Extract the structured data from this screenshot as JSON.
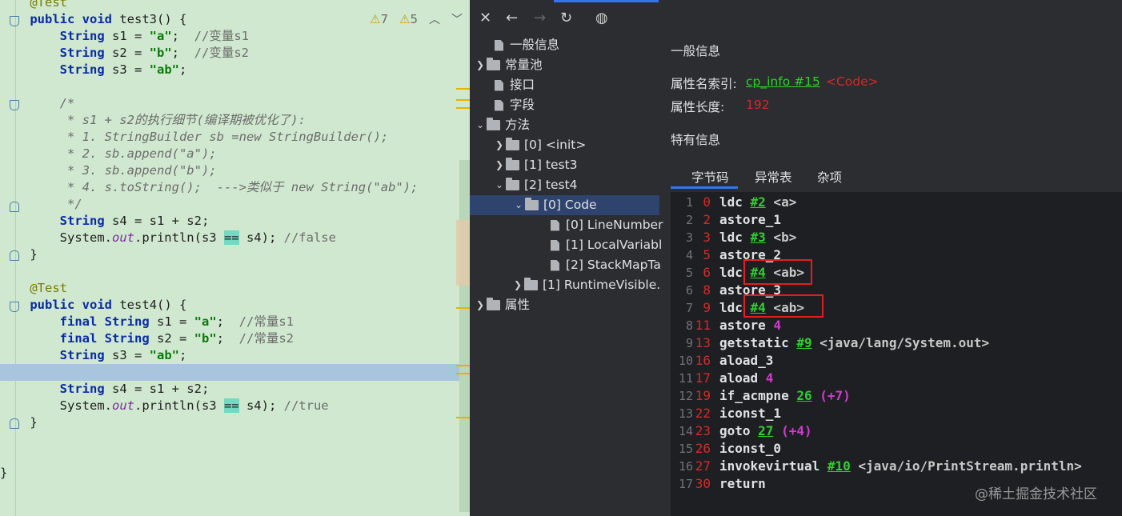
{
  "editor": {
    "inspections": {
      "warnings_a": "7",
      "warnings_b": "5"
    },
    "lines": [
      {
        "text": "    @Test"
      },
      {
        "text": "    public void test3() {"
      },
      {
        "text": "        String s1 = \"a\";  //变量s1"
      },
      {
        "text": "        String s2 = \"b\";  //变量s2"
      },
      {
        "text": "        String s3 = \"ab\";"
      },
      {
        "text": ""
      },
      {
        "text": "        /*"
      },
      {
        "text": "         * s1 + s2的执行细节(编译期被优化了):"
      },
      {
        "text": "         * 1. StringBuilder sb =new StringBuilder();"
      },
      {
        "text": "         * 2. sb.append(\"a\");"
      },
      {
        "text": "         * 3. sb.append(\"b\");"
      },
      {
        "text": "         * 4. s.toString();  --->类似于 new String(\"ab\");"
      },
      {
        "text": "         */"
      },
      {
        "text": "        String s4 = s1 + s2;"
      },
      {
        "text": "        System.out.println(s3 == s4); //false"
      },
      {
        "text": "    }"
      },
      {
        "text": ""
      },
      {
        "text": "    @Test"
      },
      {
        "text": "    public void test4() {"
      },
      {
        "text": "        final String s1 = \"a\";  //常量s1"
      },
      {
        "text": "        final String s2 = \"b\";  //常量s2"
      },
      {
        "text": "        String s3 = \"ab\";"
      },
      {
        "text": ""
      },
      {
        "text": "        String s4 = s1 + s2;"
      },
      {
        "text": "        System.out.println(s3 == s4); //true"
      },
      {
        "text": "    }"
      },
      {
        "text": ""
      },
      {
        "text": ""
      },
      {
        "text": "}"
      }
    ]
  },
  "toolbar": {
    "close_icon": "close-icon",
    "back_icon": "arrow-left-icon",
    "forward_icon": "arrow-right-icon",
    "refresh_icon": "refresh-icon",
    "web_icon": "globe-icon"
  },
  "tree": {
    "general": "一般信息",
    "constant_pool": "常量池",
    "interfaces": "接口",
    "fields": "字段",
    "methods": "方法",
    "m0": "[0] <init>",
    "m1": "[1] test3",
    "m2": "[2] test4",
    "code": "[0] Code",
    "line_number": "[0] LineNumber",
    "local_var": "[1] LocalVariabl",
    "stack_map": "[2] StackMapTa",
    "runtime_visible": "[1] RuntimeVisible.",
    "attributes": "属性"
  },
  "panel": {
    "general_title": "一般信息",
    "attr_name_label": "属性名索引:",
    "attr_name_link": "cp_info #15",
    "attr_name_value": "<Code>",
    "attr_len_label": "属性长度:",
    "attr_len_value": "192",
    "specific_title": "特有信息",
    "tabs": [
      "字节码",
      "异常表",
      "杂项"
    ]
  },
  "bytecode": [
    {
      "n": "1",
      "off": "0",
      "op": "ldc",
      "ref": "#2",
      "tail": " <a>"
    },
    {
      "n": "2",
      "off": "2",
      "op": "astore_1",
      "ref": "",
      "tail": ""
    },
    {
      "n": "3",
      "off": "3",
      "op": "ldc",
      "ref": "#3",
      "tail": " <b>"
    },
    {
      "n": "4",
      "off": "5",
      "op": "astore_2",
      "ref": "",
      "tail": ""
    },
    {
      "n": "5",
      "off": "6",
      "op": "ldc",
      "ref": "#4",
      "tail": " <ab>"
    },
    {
      "n": "6",
      "off": "8",
      "op": "astore_3",
      "ref": "",
      "tail": ""
    },
    {
      "n": "7",
      "off": "9",
      "op": "ldc",
      "ref": "#4",
      "tail": " <ab>"
    },
    {
      "n": "8",
      "off": "11",
      "op": "astore",
      "num": "4"
    },
    {
      "n": "9",
      "off": "13",
      "op": "getstatic",
      "ref": "#9",
      "tail": " <java/lang/System.out>"
    },
    {
      "n": "10",
      "off": "16",
      "op": "aload_3",
      "ref": "",
      "tail": ""
    },
    {
      "n": "11",
      "off": "17",
      "op": "aload",
      "num": "4"
    },
    {
      "n": "12",
      "off": "19",
      "op": "if_acmpne",
      "ref": "26",
      "jump": "(+7)"
    },
    {
      "n": "13",
      "off": "22",
      "op": "iconst_1",
      "ref": "",
      "tail": ""
    },
    {
      "n": "14",
      "off": "23",
      "op": "goto",
      "ref": "27",
      "jump": "(+4)"
    },
    {
      "n": "15",
      "off": "26",
      "op": "iconst_0",
      "ref": "",
      "tail": ""
    },
    {
      "n": "16",
      "off": "27",
      "op": "invokevirtual",
      "ref": "#10",
      "tail": " <java/io/PrintStream.println>"
    },
    {
      "n": "17",
      "off": "30",
      "op": "return",
      "ref": "",
      "tail": ""
    }
  ],
  "watermark": "@稀土掘金技术社区"
}
